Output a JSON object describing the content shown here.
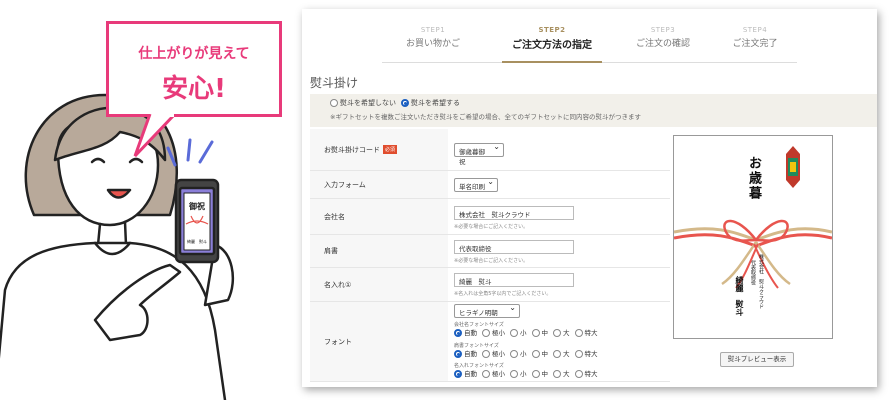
{
  "bubble": {
    "line1": "仕上がりが見えて",
    "line2": "安心!"
  },
  "steps": [
    {
      "num": "STEP1",
      "title": "お買い物かご"
    },
    {
      "num": "STEP2",
      "title": "ご注文方法の指定"
    },
    {
      "num": "STEP3",
      "title": "ご注文の確認"
    },
    {
      "num": "STEP4",
      "title": "ご注文完了"
    }
  ],
  "section_title": "熨斗掛け",
  "noshi_option": {
    "no": "熨斗を希望しない",
    "yes": "熨斗を希望する",
    "selected": "yes"
  },
  "noshi_note": "※ギフトセットを複数ご注文いただき熨斗をご希望の場合、全てのギフトセットに同内容の熨斗がつきます",
  "form": {
    "code": {
      "label": "お熨斗掛けコード",
      "required": "必須",
      "value": "御歳暮御祝"
    },
    "input_form": {
      "label": "入力フォーム",
      "value": "単名印刷"
    },
    "company": {
      "label": "会社名",
      "value": "株式会社　熨斗クラウド",
      "hint": "※必要な場合にご記入ください。"
    },
    "title": {
      "label": "肩書",
      "value": "代表取締役",
      "hint": "※必要な場合にご記入ください。"
    },
    "name": {
      "label": "名入れ①",
      "value": "綺麗　熨斗",
      "hint": "※名入れは全角5字以内でご記入ください。"
    },
    "font": {
      "label": "フォント",
      "value": "ヒラギノ明朝",
      "sizes": [
        {
          "label": "会社名フォントサイズ"
        },
        {
          "label": "肩書フォントサイズ"
        },
        {
          "label": "名入れフォントサイズ"
        }
      ],
      "options": [
        "自動",
        "極小",
        "小",
        "中",
        "大",
        "特大"
      ]
    }
  },
  "preview": {
    "omote": "お歳暮",
    "company": "株式会社　熨斗クラウド",
    "title": "代表取締役",
    "name": "綺麗　熨斗",
    "button": "熨斗プレビュー表示"
  },
  "phone_noshi": {
    "omote": "御祝",
    "name": "綺麗　熨斗"
  },
  "colors": {
    "accent": "#e83a7a",
    "step_active": "#a89060",
    "radio": "#1b5fc0",
    "required": "#e04d2e"
  }
}
